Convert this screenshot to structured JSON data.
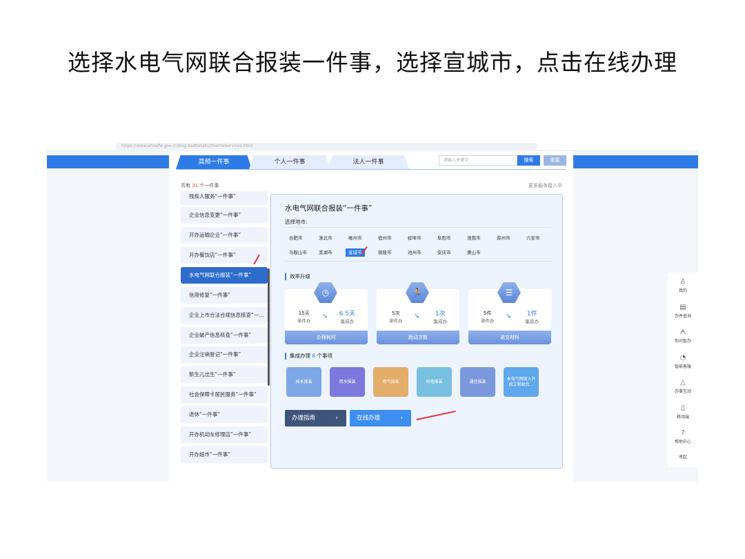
{
  "slide_title": "选择水电气网联合报装一件事，选择宣城市，点击在线办理",
  "browser": {
    "url": "https://www.ahzwfw.gov.cn/bog-bsdt/static/themeServices.html"
  },
  "tabs": [
    {
      "label": "高频一件事",
      "active": true
    },
    {
      "label": "个人一件事"
    },
    {
      "label": "法人一件事"
    }
  ],
  "search": {
    "placeholder": "请输入关键字",
    "search_label": "搜索",
    "reset_label": "重置"
  },
  "count": {
    "prefix": "共有",
    "number": "31",
    "suffix": "个一件事"
  },
  "more_text": "更多服务接入中",
  "list": [
    "残疾人服务“一件事”",
    "企业信息变更“一件事”",
    "开办运输企业“一件事”",
    "开办餐饮店“一件事”",
    "水电气网联合报装“一件事”",
    "信用修复“一件事”",
    "企业上市合法合规信息核查“一件事”",
    "企业破产信息核查“一件事”",
    "企业注销登记“一件事”",
    "新生儿出生“一件事”",
    "社会保障卡居民服务“一件事”",
    "退休“一件事”",
    "开办机动车修理店“一件事”",
    "开办超市“一件事”"
  ],
  "active_index": 4,
  "panel": {
    "title": "水电气网联合报装“一件事”",
    "city_label": "选择地市:",
    "cities": [
      "合肥市",
      "淮北市",
      "亳州市",
      "宿州市",
      "蚌埠市",
      "阜阳市",
      "淮南市",
      "滁州市",
      "六安市",
      "马鞍山市",
      "芜湖市",
      "宣城市",
      "铜陵市",
      "池州市",
      "安庆市",
      "黄山市"
    ],
    "selected_city": "宣城市",
    "efficiency_title": "效率升级",
    "cards": [
      {
        "icon": "stopwatch-icon",
        "from": "15天",
        "from_label": "单件办",
        "to": "6.5天",
        "to_label": "集成办",
        "footer": "办理耗时"
      },
      {
        "icon": "running-icon",
        "from": "5次",
        "from_label": "单件办",
        "to": "1次",
        "to_label": "集成办",
        "footer": "跑动次数"
      },
      {
        "icon": "document-icon",
        "from": "5件",
        "from_label": "单件办",
        "to": "1件",
        "to_label": "集成办",
        "footer": "递交材料"
      }
    ],
    "integrated": {
      "prefix": "集成办理",
      "count": "6",
      "suffix": "个事项"
    },
    "tiles": [
      {
        "label": "排水报装",
        "color": "#7fa6e6"
      },
      {
        "label": "用水报装",
        "color": "#7c78dc"
      },
      {
        "label": "用气报装",
        "color": "#e3ad6a"
      },
      {
        "label": "供电报装",
        "color": "#78bfe0"
      },
      {
        "label": "通信报装",
        "color": "#7b98dc"
      },
      {
        "label": "水电气网接入外线工程联合...",
        "color": "#5fa8ec"
      }
    ],
    "guide_label": "办理指南",
    "online_label": "在线办理"
  },
  "sidebar": [
    {
      "label": "我的",
      "icon": "user-icon"
    },
    {
      "label": "办件查询",
      "icon": "query-icon"
    },
    {
      "label": "你问智办",
      "icon": "ai-icon"
    },
    {
      "label": "智能客服",
      "icon": "service-icon"
    },
    {
      "label": "办事互动",
      "icon": "interact-icon"
    },
    {
      "label": "移动端",
      "icon": "mobile-icon"
    },
    {
      "label": "帮助中心",
      "icon": "help-icon"
    },
    {
      "label": "收起",
      "icon": ""
    }
  ]
}
